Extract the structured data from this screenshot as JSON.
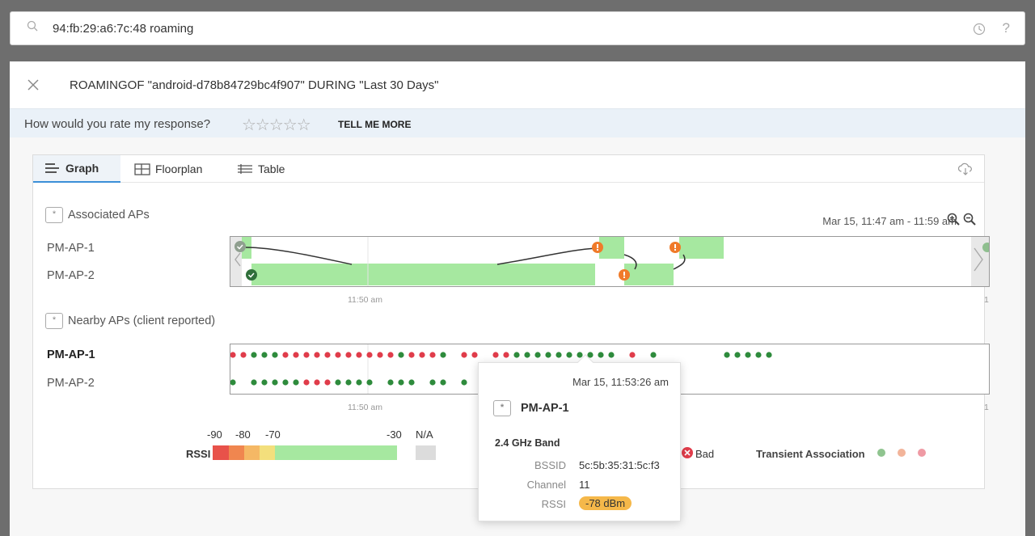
{
  "search": {
    "query": "94:fb:29:a6:7c:48 roaming",
    "help": "?"
  },
  "header": {
    "title": "ROAMINGOF \"android-d78b84729bc4f907\" DURING \"Last 30 Days\""
  },
  "rating": {
    "prompt": "How would you rate my response?",
    "stars": "☆☆☆☆☆",
    "link": "TELL ME MORE"
  },
  "tabs": [
    {
      "label": "Graph",
      "active": true
    },
    {
      "label": "Floorplan",
      "active": false
    },
    {
      "label": "Table",
      "active": false
    }
  ],
  "graph": {
    "time_range": "Mar 15, 11:47 am - 11:59 am",
    "assoc_section": "Associated APs",
    "nearby_section": "Nearby APs (client reported)",
    "section_icon": "*",
    "aps": [
      "PM-AP-1",
      "PM-AP-2"
    ],
    "axis_tick": "11:50 am",
    "axis_end": "1",
    "colors": {
      "good": "#2e8b3c",
      "bad": "#e03c4a",
      "bar": "#a6e8a0",
      "warn": "#f07b2a"
    }
  },
  "nearby_dots": {
    "ap1": "rrgggrrrrrrrrrrrgrrrg-rr-rrgggggggggg-r-g------ggggg",
    "ap2": "g-gggggrrrgggg-ggg-gg-g"
  },
  "legend": {
    "rssi_label": "RSSI",
    "ticks": [
      "-90",
      "-80",
      "-70",
      "-30",
      "N/A"
    ],
    "bad_label": "Bad",
    "transient_label": "Transient Association"
  },
  "tooltip": {
    "time": "Mar 15, 11:53:26 am",
    "ap": "PM-AP-1",
    "band": "2.4 GHz Band",
    "rows": [
      {
        "key": "BSSID",
        "value": "5c:5b:35:31:5c:f3"
      },
      {
        "key": "Channel",
        "value": "11"
      },
      {
        "key": "RSSI",
        "value": "-78 dBm"
      }
    ]
  }
}
